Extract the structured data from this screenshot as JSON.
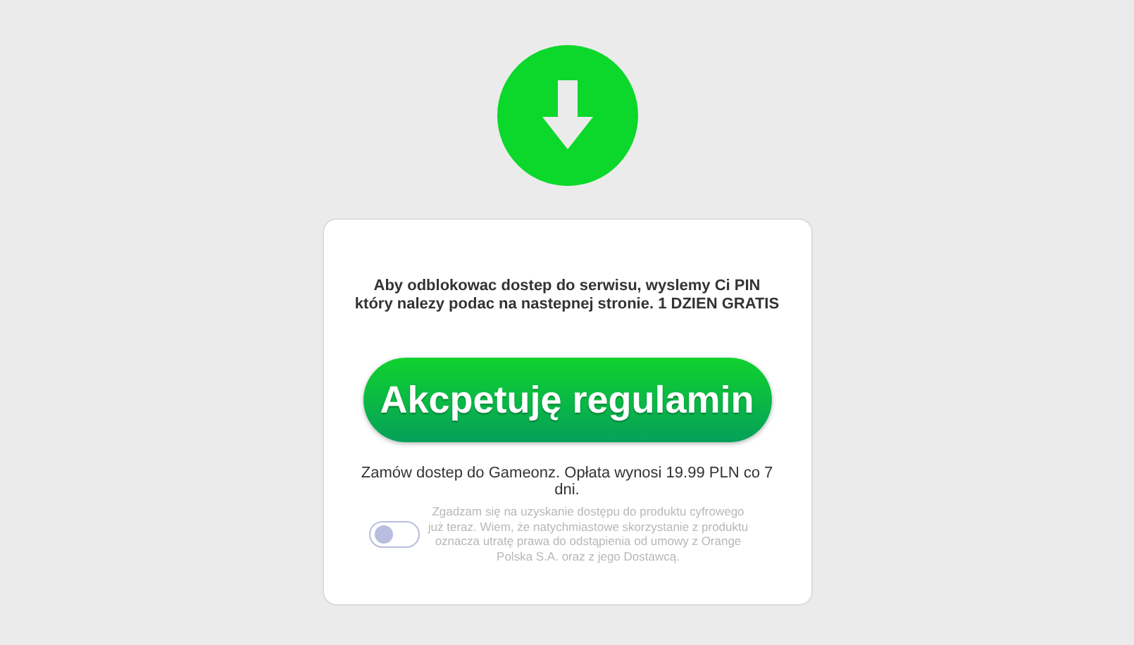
{
  "intro": "Aby odblokowac dostep do serwisu, wyslemy Ci PIN który nalezy podac na nastepnej stronie. 1 DZIEN GRATIS",
  "accept_button": "Akcpetuję regulamin",
  "price_note": "Zamów dostep do Gameonz. Opłata wynosi 19.99 PLN co 7 dni.",
  "consent": {
    "checked": false,
    "text": "Zgadzam się na uzyskanie dostępu do produktu cyfrowego już teraz. Wiem, że natychmiastowe skorzystanie z produktu oznacza utratę prawa do odstąpienia od umowy z Orange Polska S.A. oraz z jego Dostawcą."
  }
}
